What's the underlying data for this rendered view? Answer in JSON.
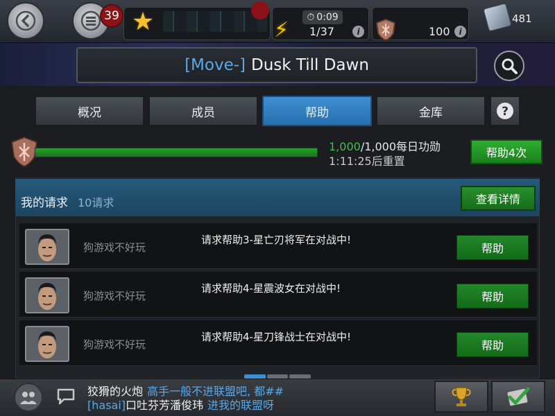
{
  "topbar": {
    "back_icon": "back-arrow-icon",
    "menu_icon": "menu-icon",
    "notification_count": "39",
    "timer": "0:09",
    "energy": "1/37",
    "glory": "100",
    "units": "481"
  },
  "alliance": {
    "tag": "[Move-]",
    "name": "Dusk Till Dawn"
  },
  "tabs": [
    {
      "label": "概况"
    },
    {
      "label": "成员"
    },
    {
      "label": "帮助",
      "active": true
    },
    {
      "label": "金库"
    }
  ],
  "progress": {
    "current": "1,000",
    "rest": "/1,000每日功勋",
    "fraction": 1.0,
    "reset": "1:11:25后重置",
    "help_all_label": "帮助4次"
  },
  "requests": {
    "title": "我的请求",
    "count": "10请求",
    "details_label": "查看详情",
    "rows": [
      {
        "name": "狗游戏不好玩",
        "message": "请求帮助3-星亡刃将军在对战中!",
        "button": "帮助"
      },
      {
        "name": "狗游戏不好玩",
        "message": "请求帮助4-星震波女在对战中!",
        "button": "帮助"
      },
      {
        "name": "狗游戏不好玩",
        "message": "请求帮助4-星刀锋战士在对战中!",
        "button": "帮助"
      }
    ]
  },
  "chat": {
    "line1_sender": "狡猾的火炮",
    "line1_message": "高手一般不进联盟吧, 都##",
    "line2_tag": "[hasai]",
    "line2_sender": "口吐芬芳潘俊玮",
    "line2_message": "进我的联盟呀"
  },
  "colors": {
    "accent_blue": "#3d8fd2",
    "help_green": "#22882a",
    "progress_green": "#2aa02c"
  }
}
